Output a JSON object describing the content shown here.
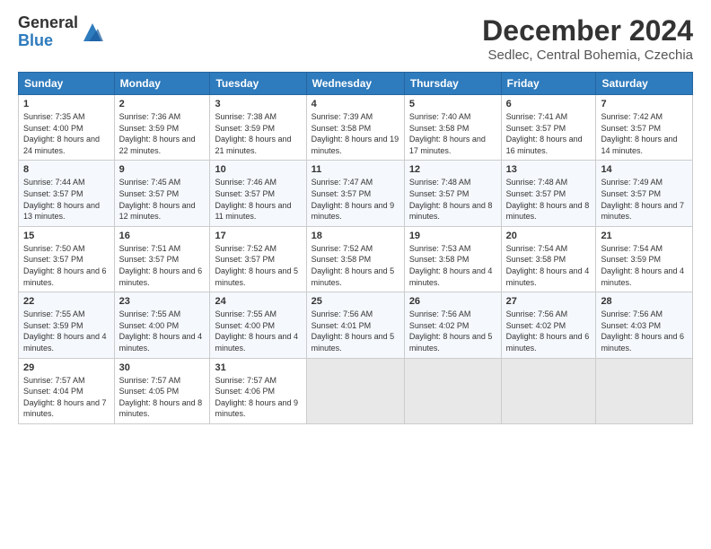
{
  "logo": {
    "general": "General",
    "blue": "Blue"
  },
  "title": "December 2024",
  "subtitle": "Sedlec, Central Bohemia, Czechia",
  "headers": [
    "Sunday",
    "Monday",
    "Tuesday",
    "Wednesday",
    "Thursday",
    "Friday",
    "Saturday"
  ],
  "weeks": [
    [
      {
        "day": "1",
        "sunrise": "7:35 AM",
        "sunset": "4:00 PM",
        "daylight": "8 hours and 24 minutes."
      },
      {
        "day": "2",
        "sunrise": "7:36 AM",
        "sunset": "3:59 PM",
        "daylight": "8 hours and 22 minutes."
      },
      {
        "day": "3",
        "sunrise": "7:38 AM",
        "sunset": "3:59 PM",
        "daylight": "8 hours and 21 minutes."
      },
      {
        "day": "4",
        "sunrise": "7:39 AM",
        "sunset": "3:58 PM",
        "daylight": "8 hours and 19 minutes."
      },
      {
        "day": "5",
        "sunrise": "7:40 AM",
        "sunset": "3:58 PM",
        "daylight": "8 hours and 17 minutes."
      },
      {
        "day": "6",
        "sunrise": "7:41 AM",
        "sunset": "3:57 PM",
        "daylight": "8 hours and 16 minutes."
      },
      {
        "day": "7",
        "sunrise": "7:42 AM",
        "sunset": "3:57 PM",
        "daylight": "8 hours and 14 minutes."
      }
    ],
    [
      {
        "day": "8",
        "sunrise": "7:44 AM",
        "sunset": "3:57 PM",
        "daylight": "8 hours and 13 minutes."
      },
      {
        "day": "9",
        "sunrise": "7:45 AM",
        "sunset": "3:57 PM",
        "daylight": "8 hours and 12 minutes."
      },
      {
        "day": "10",
        "sunrise": "7:46 AM",
        "sunset": "3:57 PM",
        "daylight": "8 hours and 11 minutes."
      },
      {
        "day": "11",
        "sunrise": "7:47 AM",
        "sunset": "3:57 PM",
        "daylight": "8 hours and 9 minutes."
      },
      {
        "day": "12",
        "sunrise": "7:48 AM",
        "sunset": "3:57 PM",
        "daylight": "8 hours and 8 minutes."
      },
      {
        "day": "13",
        "sunrise": "7:48 AM",
        "sunset": "3:57 PM",
        "daylight": "8 hours and 8 minutes."
      },
      {
        "day": "14",
        "sunrise": "7:49 AM",
        "sunset": "3:57 PM",
        "daylight": "8 hours and 7 minutes."
      }
    ],
    [
      {
        "day": "15",
        "sunrise": "7:50 AM",
        "sunset": "3:57 PM",
        "daylight": "8 hours and 6 minutes."
      },
      {
        "day": "16",
        "sunrise": "7:51 AM",
        "sunset": "3:57 PM",
        "daylight": "8 hours and 6 minutes."
      },
      {
        "day": "17",
        "sunrise": "7:52 AM",
        "sunset": "3:57 PM",
        "daylight": "8 hours and 5 minutes."
      },
      {
        "day": "18",
        "sunrise": "7:52 AM",
        "sunset": "3:58 PM",
        "daylight": "8 hours and 5 minutes."
      },
      {
        "day": "19",
        "sunrise": "7:53 AM",
        "sunset": "3:58 PM",
        "daylight": "8 hours and 4 minutes."
      },
      {
        "day": "20",
        "sunrise": "7:54 AM",
        "sunset": "3:58 PM",
        "daylight": "8 hours and 4 minutes."
      },
      {
        "day": "21",
        "sunrise": "7:54 AM",
        "sunset": "3:59 PM",
        "daylight": "8 hours and 4 minutes."
      }
    ],
    [
      {
        "day": "22",
        "sunrise": "7:55 AM",
        "sunset": "3:59 PM",
        "daylight": "8 hours and 4 minutes."
      },
      {
        "day": "23",
        "sunrise": "7:55 AM",
        "sunset": "4:00 PM",
        "daylight": "8 hours and 4 minutes."
      },
      {
        "day": "24",
        "sunrise": "7:55 AM",
        "sunset": "4:00 PM",
        "daylight": "8 hours and 4 minutes."
      },
      {
        "day": "25",
        "sunrise": "7:56 AM",
        "sunset": "4:01 PM",
        "daylight": "8 hours and 5 minutes."
      },
      {
        "day": "26",
        "sunrise": "7:56 AM",
        "sunset": "4:02 PM",
        "daylight": "8 hours and 5 minutes."
      },
      {
        "day": "27",
        "sunrise": "7:56 AM",
        "sunset": "4:02 PM",
        "daylight": "8 hours and 6 minutes."
      },
      {
        "day": "28",
        "sunrise": "7:56 AM",
        "sunset": "4:03 PM",
        "daylight": "8 hours and 6 minutes."
      }
    ],
    [
      {
        "day": "29",
        "sunrise": "7:57 AM",
        "sunset": "4:04 PM",
        "daylight": "8 hours and 7 minutes."
      },
      {
        "day": "30",
        "sunrise": "7:57 AM",
        "sunset": "4:05 PM",
        "daylight": "8 hours and 8 minutes."
      },
      {
        "day": "31",
        "sunrise": "7:57 AM",
        "sunset": "4:06 PM",
        "daylight": "8 hours and 9 minutes."
      },
      null,
      null,
      null,
      null
    ]
  ]
}
